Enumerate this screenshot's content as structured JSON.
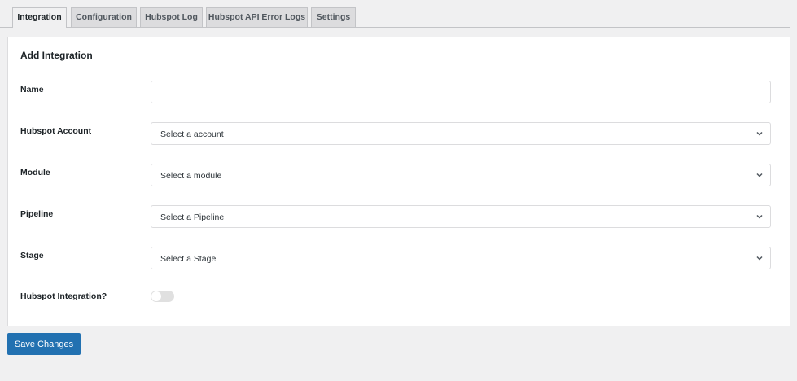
{
  "tabs": [
    "Integration",
    "Configuration",
    "Hubspot Log",
    "Hubspot API Error Logs",
    "Settings"
  ],
  "panel": {
    "title": "Add Integration",
    "fields": [
      {
        "label": "Name",
        "value": ""
      },
      {
        "label": "Hubspot Account",
        "placeholder": "Select a account"
      },
      {
        "label": "Module",
        "placeholder": "Select a module"
      },
      {
        "label": "Pipeline",
        "placeholder": "Select a Pipeline"
      },
      {
        "label": "Stage",
        "placeholder": "Select a Stage"
      }
    ],
    "toggle": {
      "label": "Hubspot Integration?",
      "on": false
    }
  },
  "save_label": "Save Changes"
}
